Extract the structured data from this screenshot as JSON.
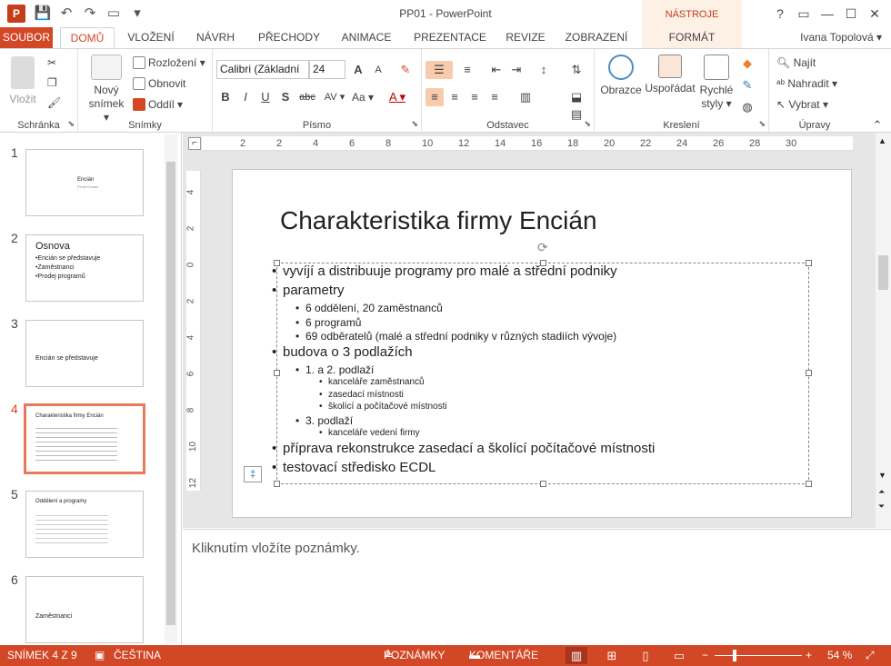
{
  "window": {
    "title": "PP01 - PowerPoint",
    "context_tab_title": "NÁSTROJE KRESLENÍ"
  },
  "qat": {
    "app_icon": "P",
    "save_icon": "💾",
    "undo_icon": "↶",
    "redo_icon": "↷",
    "present_icon": "▭",
    "more_icon": "▾"
  },
  "winctl": {
    "help": "?",
    "ribbon_opts": "▭",
    "minimize": "—",
    "maximize": "☐",
    "close": "✕"
  },
  "tabs": [
    {
      "label": "SOUBOR"
    },
    {
      "label": "DOMŮ"
    },
    {
      "label": "VLOŽENÍ"
    },
    {
      "label": "NÁVRH"
    },
    {
      "label": "PŘECHODY"
    },
    {
      "label": "ANIMACE"
    },
    {
      "label": "PREZENTACE"
    },
    {
      "label": "REVIZE"
    },
    {
      "label": "ZOBRAZENÍ"
    },
    {
      "label": "FORMÁT"
    }
  ],
  "user": "Ivana Topolová ▾",
  "ribbon": {
    "clipboard": {
      "label": "Schránka",
      "paste": "Vložit"
    },
    "slides": {
      "label": "Snímky",
      "new_slide_1": "Nový",
      "new_slide_2": "snímek ▾",
      "layout": "Rozložení ▾",
      "reset": "Obnovit",
      "section": "Oddíl ▾"
    },
    "font": {
      "label": "Písmo",
      "font_name": "Calibri (Základní",
      "font_size": "24",
      "bold": "B",
      "italic": "I",
      "underline": "U",
      "shadow": "S",
      "strike": "abc",
      "spacing": "AV ▾",
      "case": "Aa ▾",
      "color": "A ▾",
      "grow": "A",
      "shrink": "A",
      "clear": "✎"
    },
    "paragraph": {
      "label": "Odstavec"
    },
    "drawing": {
      "label": "Kreslení",
      "shapes": "Obrazce",
      "arrange": "Uspořádat",
      "quick_styles_1": "Rychlé",
      "quick_styles_2": "styly ▾"
    },
    "editing": {
      "label": "Úpravy",
      "find": "Najít",
      "replace": "Nahradit ▾",
      "select": "Vybrat ▾"
    }
  },
  "thumbnails": [
    {
      "num": "1",
      "lines": [
        "Encián",
        "Firmit Encián"
      ]
    },
    {
      "num": "2",
      "lines": [
        "Osnova",
        "•Encián se představuje",
        "•Zaměstnanci",
        "•Prodej programů"
      ]
    },
    {
      "num": "3",
      "lines": [
        "Encián se představuje"
      ]
    },
    {
      "num": "4",
      "lines": [
        "Charakteristika firmy Encián"
      ]
    },
    {
      "num": "5",
      "lines": [
        "Oddělení a programy"
      ]
    },
    {
      "num": "6",
      "lines": [
        "Zaměstnanci"
      ]
    }
  ],
  "ruler_h": [
    "2",
    "2",
    "4",
    "6",
    "8",
    "10",
    "12",
    "14",
    "16",
    "18",
    "20",
    "22",
    "24",
    "26",
    "28",
    "30"
  ],
  "ruler_v": [
    "4",
    "2",
    "0",
    "2",
    "4",
    "6",
    "8",
    "10",
    "12"
  ],
  "slide": {
    "title": "Charakteristika firmy Encián",
    "bullets": [
      {
        "level": 1,
        "text": "vyvíjí a distribuuje programy pro malé a střední podniky"
      },
      {
        "level": 1,
        "text": "parametry"
      },
      {
        "level": 2,
        "text": "6 oddělení, 20 zaměstnanců"
      },
      {
        "level": 2,
        "text": "6 programů"
      },
      {
        "level": 2,
        "text": "69 odběratelů (malé a střední podniky v různých stadiích vývoje)"
      },
      {
        "level": 1,
        "text": "budova o 3 podlažích"
      },
      {
        "level": 2,
        "text": "1. a 2. podlaží"
      },
      {
        "level": 3,
        "text": "kanceláře zaměstnanců"
      },
      {
        "level": 3,
        "text": "zasedací místnosti"
      },
      {
        "level": 3,
        "text": "školící a počítačové místnosti"
      },
      {
        "level": 2,
        "text": "3. podlaží"
      },
      {
        "level": 3,
        "text": "kanceláře vedení firmy"
      },
      {
        "level": 1,
        "text": "příprava rekonstrukce zasedací a školící počítačové místnosti"
      },
      {
        "level": 1,
        "text": "testovací středisko ECDL"
      }
    ]
  },
  "notes": {
    "placeholder": "Kliknutím vložíte poznámky."
  },
  "status": {
    "slide": "SNÍMEK 4 Z 9",
    "language": "ČEŠTINA",
    "notes": "POZNÁMKY",
    "comments": "KOMENTÁŘE",
    "zoom_minus": "−",
    "zoom_plus": "+",
    "zoom": "54 %",
    "fit": "⤢"
  },
  "colors": {
    "accent": "#d24726",
    "selected_thumb": "#e8795b"
  }
}
